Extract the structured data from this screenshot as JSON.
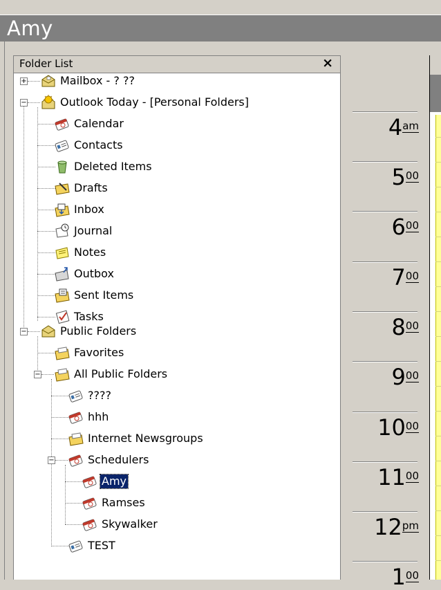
{
  "window": {
    "title": "Amy"
  },
  "folder_list": {
    "header": "Folder List",
    "close_label": "×",
    "items": [
      {
        "label": "Mailbox - ? ??",
        "icon": "mailbox-icon"
      },
      {
        "label": "Outlook Today - [Personal Folders]",
        "icon": "outlook-today-icon"
      },
      {
        "label": "Calendar",
        "icon": "calendar-icon"
      },
      {
        "label": "Contacts",
        "icon": "contacts-icon"
      },
      {
        "label": "Deleted Items",
        "icon": "trash-icon"
      },
      {
        "label": "Drafts",
        "icon": "drafts-icon"
      },
      {
        "label": "Inbox",
        "icon": "inbox-icon"
      },
      {
        "label": "Journal",
        "icon": "journal-icon"
      },
      {
        "label": "Notes",
        "icon": "notes-icon"
      },
      {
        "label": "Outbox",
        "icon": "outbox-icon"
      },
      {
        "label": "Sent Items",
        "icon": "sent-items-icon"
      },
      {
        "label": "Tasks",
        "icon": "tasks-icon"
      },
      {
        "label": "Public Folders",
        "icon": "public-folders-icon"
      },
      {
        "label": "Favorites",
        "icon": "folder-icon"
      },
      {
        "label": "All Public Folders",
        "icon": "folder-icon"
      },
      {
        "label": "????",
        "icon": "contacts-icon"
      },
      {
        "label": "hhh",
        "icon": "calendar-icon"
      },
      {
        "label": "Internet Newsgroups",
        "icon": "folder-icon"
      },
      {
        "label": "Schedulers",
        "icon": "calendar-icon"
      },
      {
        "label": "Amy",
        "icon": "calendar-icon",
        "selected": true
      },
      {
        "label": "Ramses",
        "icon": "calendar-icon"
      },
      {
        "label": "Skywalker",
        "icon": "calendar-icon"
      },
      {
        "label": "TEST",
        "icon": "contacts-icon"
      }
    ]
  },
  "calendar": {
    "hours": [
      {
        "hour": "4",
        "suffix": "am"
      },
      {
        "hour": "5",
        "suffix": "00"
      },
      {
        "hour": "6",
        "suffix": "00"
      },
      {
        "hour": "7",
        "suffix": "00"
      },
      {
        "hour": "8",
        "suffix": "00"
      },
      {
        "hour": "9",
        "suffix": "00"
      },
      {
        "hour": "10",
        "suffix": "00"
      },
      {
        "hour": "11",
        "suffix": "00"
      },
      {
        "hour": "12",
        "suffix": "pm"
      },
      {
        "hour": "1",
        "suffix": "00"
      }
    ]
  },
  "colors": {
    "selection": "#0a246a",
    "titlebar": "#808080",
    "work_hours": "#ffff99"
  }
}
